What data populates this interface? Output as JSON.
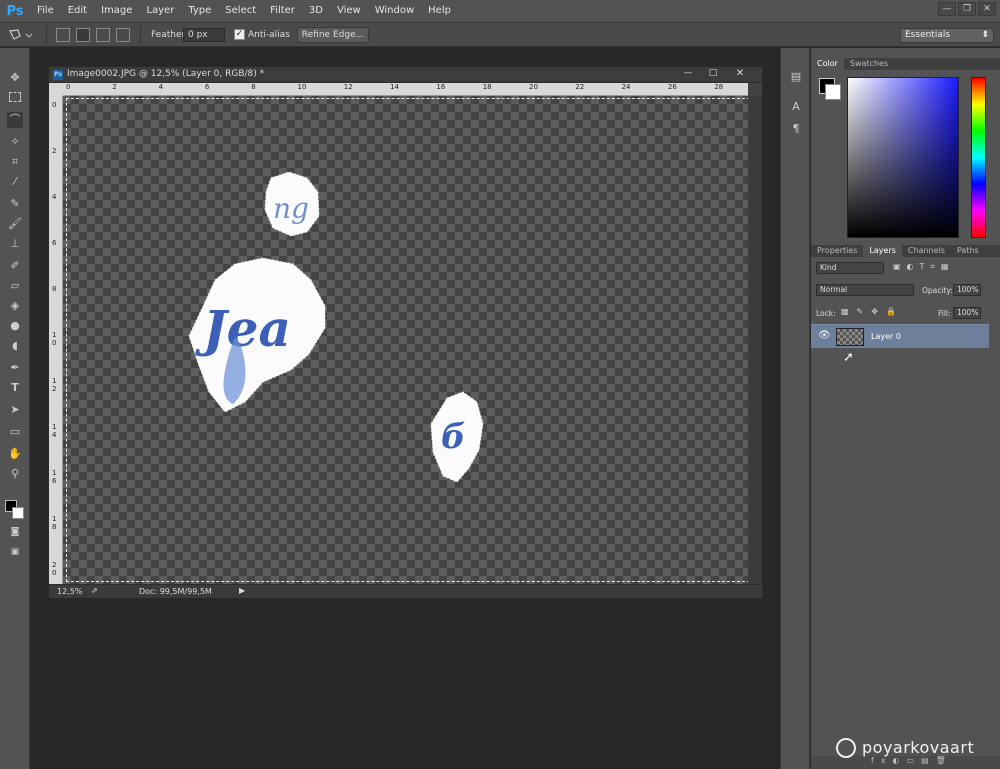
{
  "app": {
    "logo": "Ps"
  },
  "menu": [
    "File",
    "Edit",
    "Image",
    "Layer",
    "Type",
    "Select",
    "Filter",
    "3D",
    "View",
    "Window",
    "Help"
  ],
  "options": {
    "feather_label": "Feather:",
    "feather_value": "0 px",
    "antialias_label": "Anti-alias",
    "refine_edge": "Refine Edge...",
    "workspace": "Essentials"
  },
  "document": {
    "title": "Image0002.JPG @ 12,5% (Layer 0, RGB/8) *",
    "zoom": "12,5%",
    "doc_info": "Doc: 99,5M/99,5M",
    "hruler": [
      "0",
      "2",
      "4",
      "6",
      "8",
      "10",
      "12",
      "14",
      "16",
      "18",
      "20",
      "22",
      "24",
      "26",
      "28"
    ],
    "vruler": [
      "0",
      "2",
      "4",
      "6",
      "8",
      "1\n0",
      "1\n2",
      "1\n4",
      "1\n6",
      "1\n8",
      "2\n0"
    ]
  },
  "panels": {
    "color_tabs": [
      "Color",
      "Swatches"
    ],
    "layer_tabs": [
      "Properties",
      "Layers",
      "Channels",
      "Paths"
    ],
    "kind_label": "Kind",
    "blend_mode": "Normal",
    "opacity_label": "Opacity:",
    "opacity_value": "100%",
    "lock_label": "Lock:",
    "fill_label": "Fill:",
    "fill_value": "100%",
    "layer_name": "Layer 0"
  },
  "watermark": "poyarkovaart"
}
